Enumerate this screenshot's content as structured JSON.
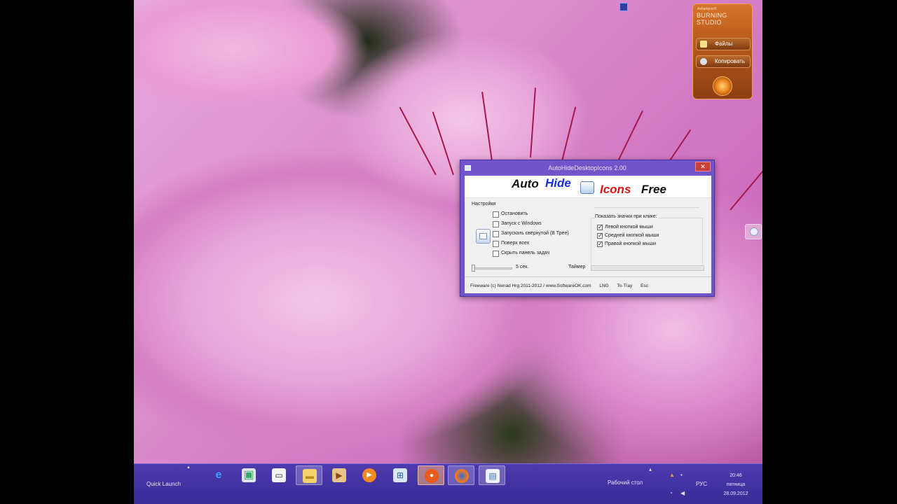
{
  "window": {
    "title": "AutoHideDesktopIcons 2.00",
    "close_label": "✕",
    "banner": {
      "word1": "Auto",
      "word2": "Hide",
      "word3": "Icons",
      "word4": "Free"
    },
    "settings_label": "Настройки",
    "options": [
      {
        "label": "Остановить",
        "checked": false
      },
      {
        "label": "Запуск с Windows",
        "checked": false
      },
      {
        "label": "Запускать свёрнутой (В Трее)",
        "checked": false
      },
      {
        "label": "Поверх всех",
        "checked": false
      },
      {
        "label": "Скрыть панель задач",
        "checked": false
      }
    ],
    "show_icons_label": "Показать значки при клике:",
    "click_options": [
      {
        "label": "Левой кнопкой мыши",
        "checked": true,
        "mark": "✓"
      },
      {
        "label": "Средней кнопкой мыши",
        "checked": true,
        "mark": "✓"
      },
      {
        "label": "Правой кнопкой мыши",
        "checked": true,
        "mark": "✓"
      }
    ],
    "seconds_label": "5 сек.",
    "timer_label": "Таймер",
    "footer": {
      "copyright": "Freeware (c) Nenad Hrg 2011-2012 / www.SoftwareOK.com",
      "lng": "LNG",
      "to_tray": "To-Tray",
      "esc": "Esc"
    }
  },
  "gadget": {
    "brand_small": "Ashampoo®",
    "brand": "BURNING STUDIO",
    "btn_files": "Файлы",
    "btn_copy": "Копировать"
  },
  "taskbar": {
    "quick_launch": "Quick Launch",
    "desktop_label": "Рабочий стол",
    "language": "РУС",
    "time": "20:46",
    "day": "пятница",
    "date": "28.09.2012",
    "icons": [
      "ie-icon",
      "explorer-icon",
      "media-icon",
      "folder-icon",
      "video-icon",
      "player-icon",
      "network-icon",
      "burning-icon",
      "firefox-icon",
      "autohide-icon"
    ]
  }
}
